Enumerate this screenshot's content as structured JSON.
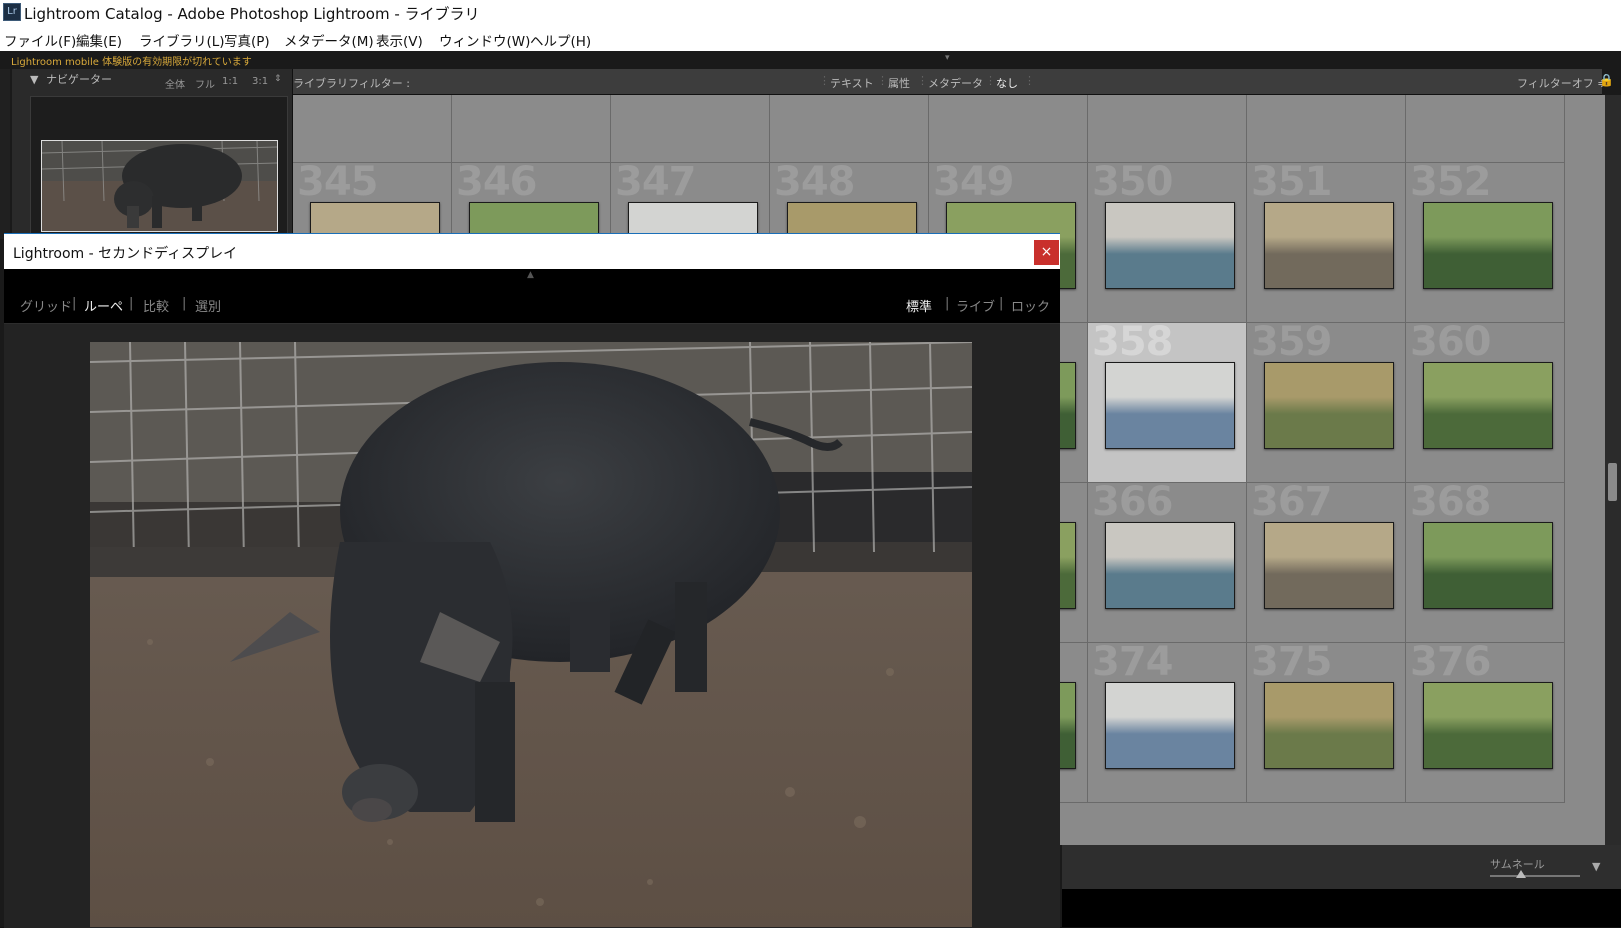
{
  "window": {
    "title": "Lightroom Catalog - Adobe Photoshop Lightroom - ライブラリ",
    "app_icon_text": "Lr"
  },
  "menu": [
    "ファイル(F)",
    "編集(E)",
    "ライブラリ(L)",
    "写真(P)",
    "メタデータ(M)",
    "表示(V)",
    "ウィンドウ(W)",
    "ヘルプ(H)"
  ],
  "mobile_warning": "Lightroom mobile 体験版の有効期限が切れています",
  "navigator": {
    "title": "ナビゲーター",
    "zoom_options": [
      "全体",
      "フル",
      "1:1",
      "3:1"
    ]
  },
  "filter_bar": {
    "label": "ライブラリフィルター :",
    "options": [
      "テキスト",
      "属性",
      "メタデータ",
      "なし"
    ],
    "active": "なし",
    "filter_off": "フィルターオフ ≑"
  },
  "grid": {
    "rows": [
      {
        "numbers": [
          "",
          "",
          "",
          "",
          "",
          "",
          "",
          ""
        ],
        "stars": {
          "6": "★★★"
        }
      },
      {
        "numbers": [
          "345",
          "346",
          "347",
          "348",
          "349",
          "350",
          "351",
          "352"
        ]
      },
      {
        "numbers": [
          "",
          "",
          "",
          "",
          "",
          "358",
          "359",
          "360"
        ],
        "selected": 5
      },
      {
        "numbers": [
          "",
          "",
          "",
          "",
          "",
          "366",
          "367",
          "368"
        ]
      },
      {
        "numbers": [
          "",
          "",
          "",
          "",
          "",
          "374",
          "375",
          "376"
        ]
      }
    ]
  },
  "toolbar": {
    "thumbnail_label": "サムネール"
  },
  "second_display": {
    "title": "Lightroom - セカンドディスプレイ",
    "close_label": "×",
    "left_views": [
      "グリッド",
      "ルーペ",
      "比較",
      "選別"
    ],
    "left_active": "ルーペ",
    "right_modes": [
      "標準",
      "ライブ",
      "ロック"
    ],
    "right_active": "標準"
  },
  "colors": {
    "accent_warning": "#d8a93b",
    "close_button": "#c9302c",
    "grid_bg": "#8b8b8b",
    "grid_selected": "#c4c4c4"
  }
}
